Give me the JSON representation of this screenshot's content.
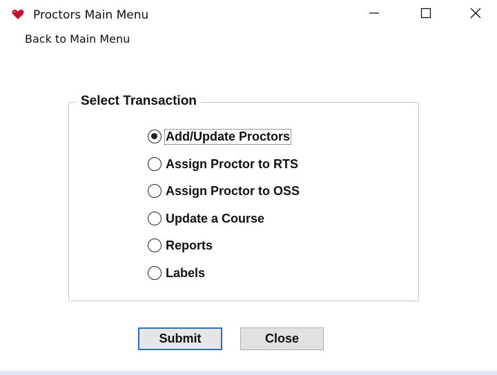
{
  "window": {
    "title": "Proctors Main Menu",
    "icon": "heart-icon",
    "controls": [
      "minimize-icon",
      "maximize-icon",
      "close-icon"
    ]
  },
  "menu": {
    "items": [
      "Back to Main Menu"
    ]
  },
  "transaction_group": {
    "legend": "Select Transaction",
    "selected_index": 0,
    "options": [
      "Add/Update Proctors",
      "Assign Proctor to RTS",
      "Assign Proctor to OSS",
      "Update a Course",
      "Reports",
      "Labels"
    ]
  },
  "buttons": {
    "submit_label": "Submit",
    "close_label": "Close"
  },
  "colors": {
    "icon_red": "#c8102e",
    "focus_border": "#2d6fc7"
  }
}
